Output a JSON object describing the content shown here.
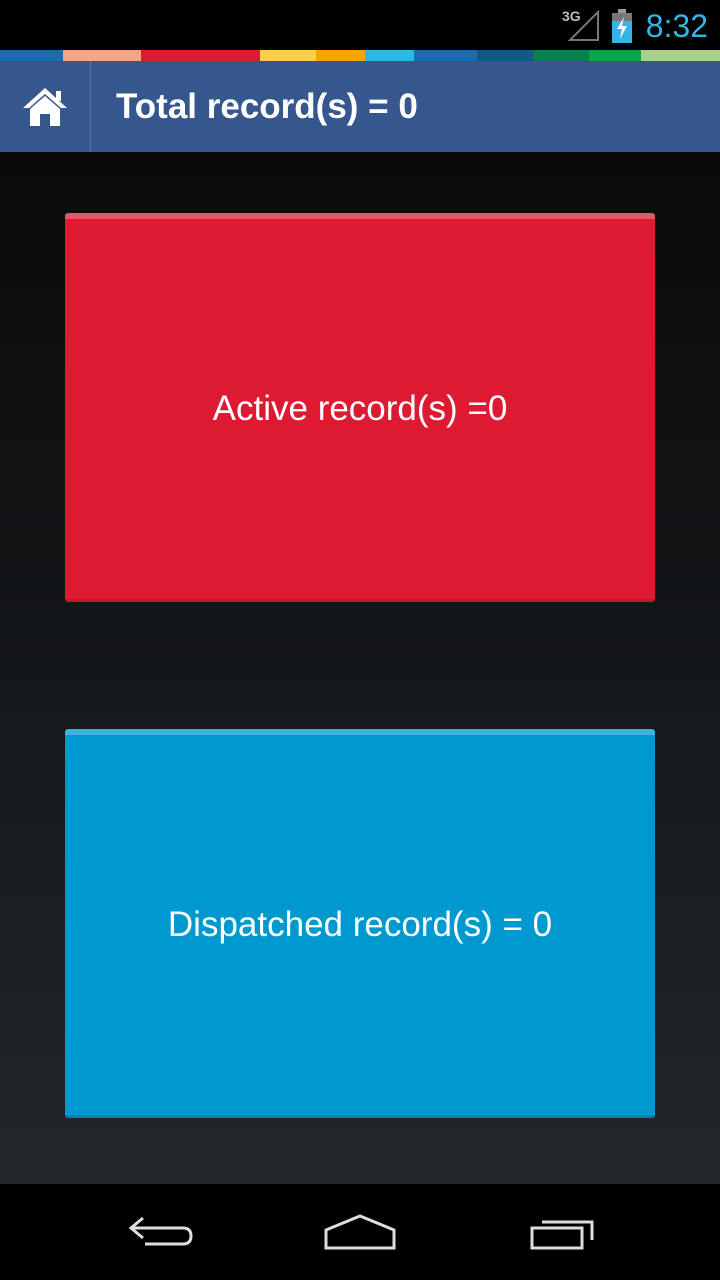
{
  "status_bar": {
    "network": "3G",
    "time": "8:32",
    "icons": [
      "signal-icon",
      "battery-charging-icon"
    ],
    "clock_color": "#33b5e5"
  },
  "color_strip": [
    "#1a6bb0",
    "#f7a486",
    "#df1a33",
    "#df1a33",
    "#fccf4a",
    "#f7a600",
    "#31b6e7",
    "#1a6bb0",
    "#0f5a8a",
    "#0b7d4f",
    "#11a04b",
    "#a9d18e"
  ],
  "action_bar": {
    "home_icon": "home-icon",
    "title": "Total record(s) = 0",
    "background": "#35578e"
  },
  "cards": {
    "active": {
      "label": "Active record(s) =0",
      "color": "#de1a33"
    },
    "dispatched": {
      "label": "Dispatched record(s) = 0",
      "color": "#0099cf"
    }
  },
  "nav_bar": {
    "icons": [
      "back-icon",
      "home-icon",
      "recent-apps-icon"
    ]
  }
}
